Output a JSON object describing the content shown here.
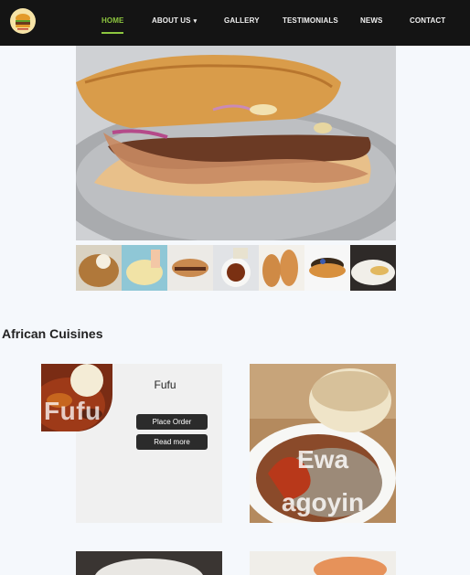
{
  "nav": {
    "logo_icon": "burger-logo-icon",
    "items": [
      {
        "label": "HOME",
        "active": true
      },
      {
        "label": "ABOUT US",
        "has_dropdown": true
      },
      {
        "label": "GALLERY"
      },
      {
        "label": "TESTIMONIALS"
      },
      {
        "label": "NEWS"
      },
      {
        "label": "CONTACT"
      }
    ],
    "active_color": "#8dc63f",
    "background": "#141414"
  },
  "hero": {
    "image": "burger-hero-image"
  },
  "thumbnails": [
    "egusi-rice-thumb",
    "fries-sauce-thumb",
    "burger-thumb",
    "fufu-soup-thumb",
    "bread-rolls-thumb",
    "pancakes-thumb",
    "plate-dish-thumb"
  ],
  "section": {
    "title": "African Cuisines"
  },
  "cards": {
    "fufu": {
      "image_caption": "Fufu",
      "title": "Fufu",
      "order_label": "Place Order",
      "read_label": "Read more"
    },
    "ewa": {
      "caption_line1": "Ewa",
      "caption_line2": "agoyin"
    }
  }
}
